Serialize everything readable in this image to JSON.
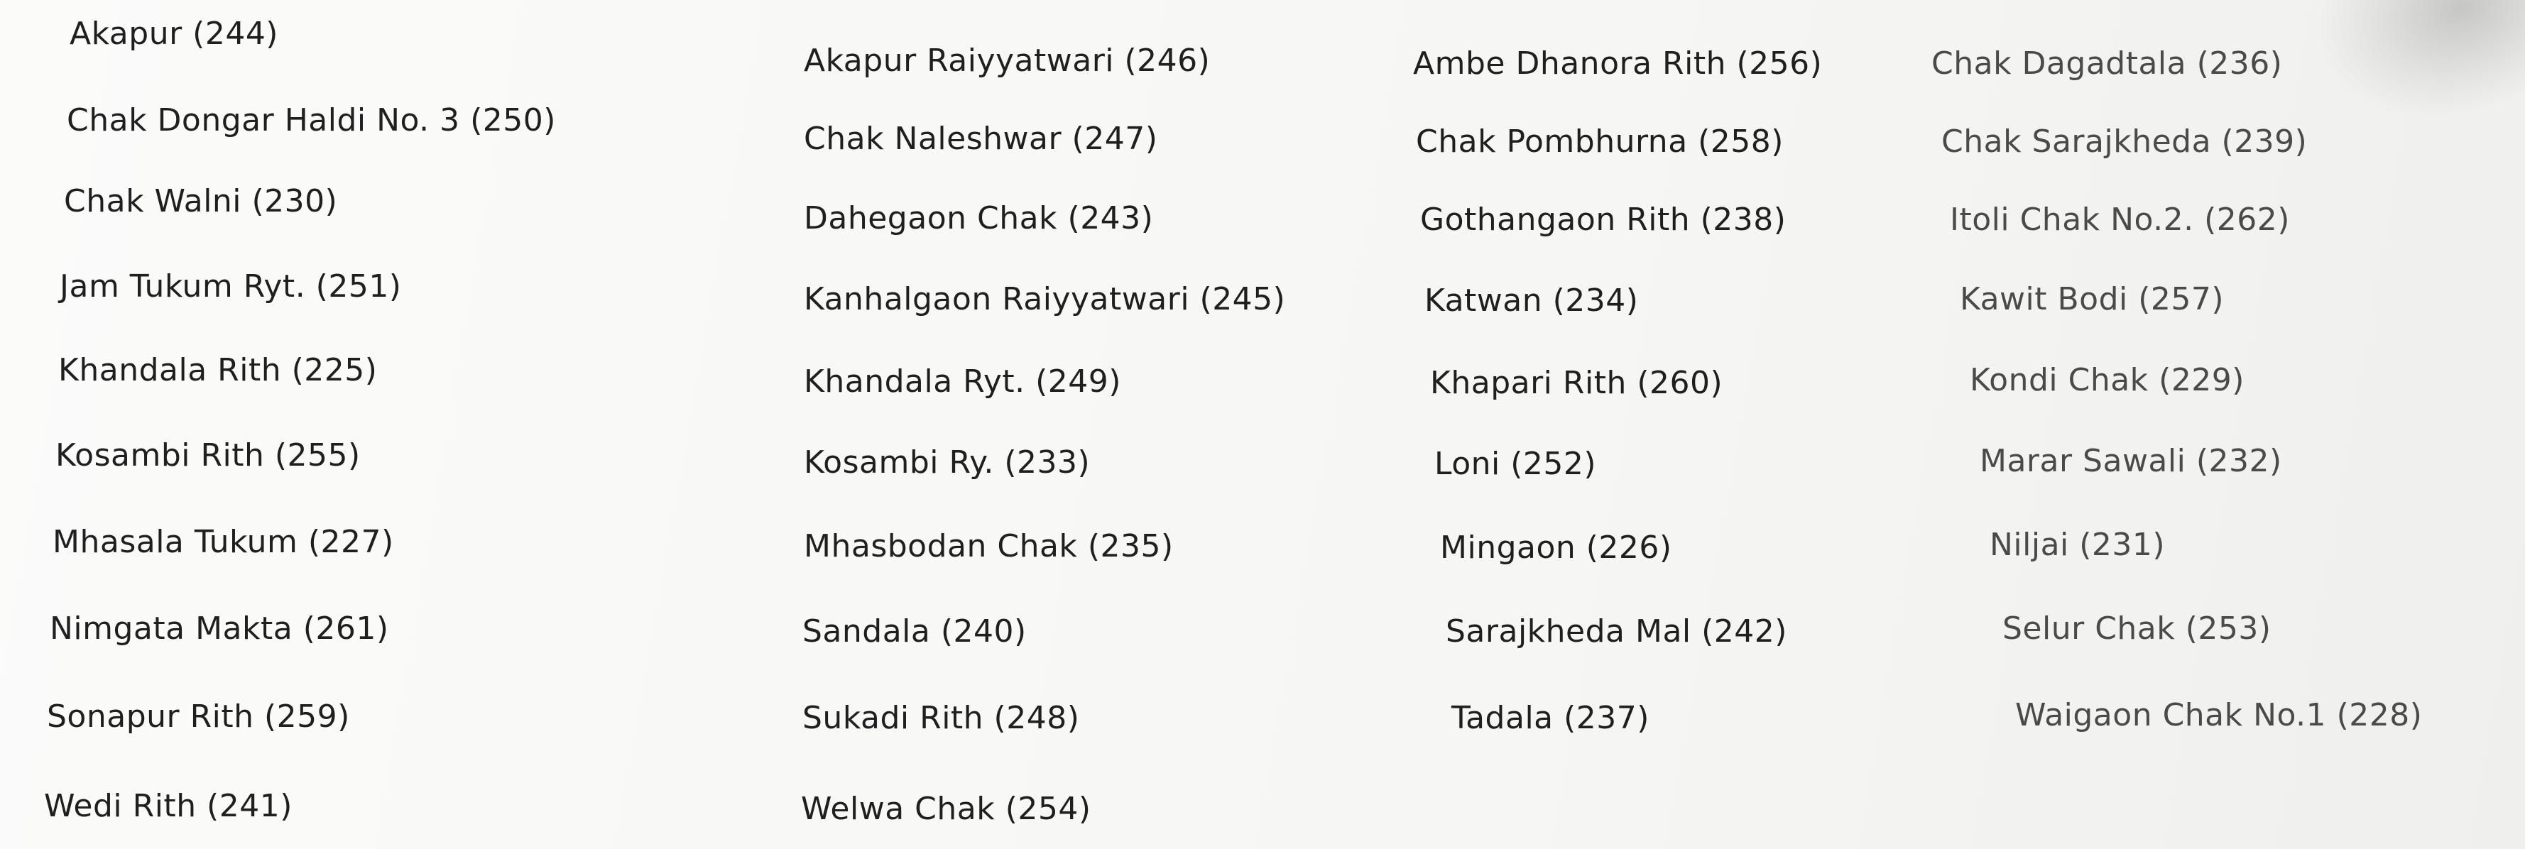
{
  "villages": [
    "Akapur (244)",
    "Chak Dongar Haldi No. 3 (250)",
    "Chak Walni (230)",
    "Jam Tukum Ryt. (251)",
    "Khandala Rith (225)",
    "Kosambi Rith (255)",
    "Mhasala Tukum (227)",
    "Nimgata Makta (261)",
    "Sonapur Rith (259)",
    "Wedi Rith (241)",
    "Akapur Raiyyatwari (246)",
    "Chak Naleshwar (247)",
    "Dahegaon Chak (243)",
    "Kanhalgaon Raiyyatwari (245)",
    "Khandala Ryt. (249)",
    "Kosambi Ry. (233)",
    "Mhasbodan Chak (235)",
    "Sandala (240)",
    "Sukadi Rith (248)",
    "Welwa Chak (254)",
    "Ambe Dhanora Rith (256)",
    "Chak Pombhurna (258)",
    "Gothangaon Rith (238)",
    "Katwan (234)",
    "Khapari Rith (260)",
    "Loni (252)",
    "Mingaon (226)",
    "Sarajkheda Mal (242)",
    "Tadala (237)",
    "Chak Dagadtala (236)",
    "Chak Sarajkheda (239)",
    "Itoli Chak No.2. (262)",
    "Kawit Bodi (257)",
    "Kondi Chak (229)",
    "Marar Sawali (232)",
    "Niljai (231)",
    "Selur Chak (253)",
    "Waigaon Chak No.1 (228)"
  ]
}
